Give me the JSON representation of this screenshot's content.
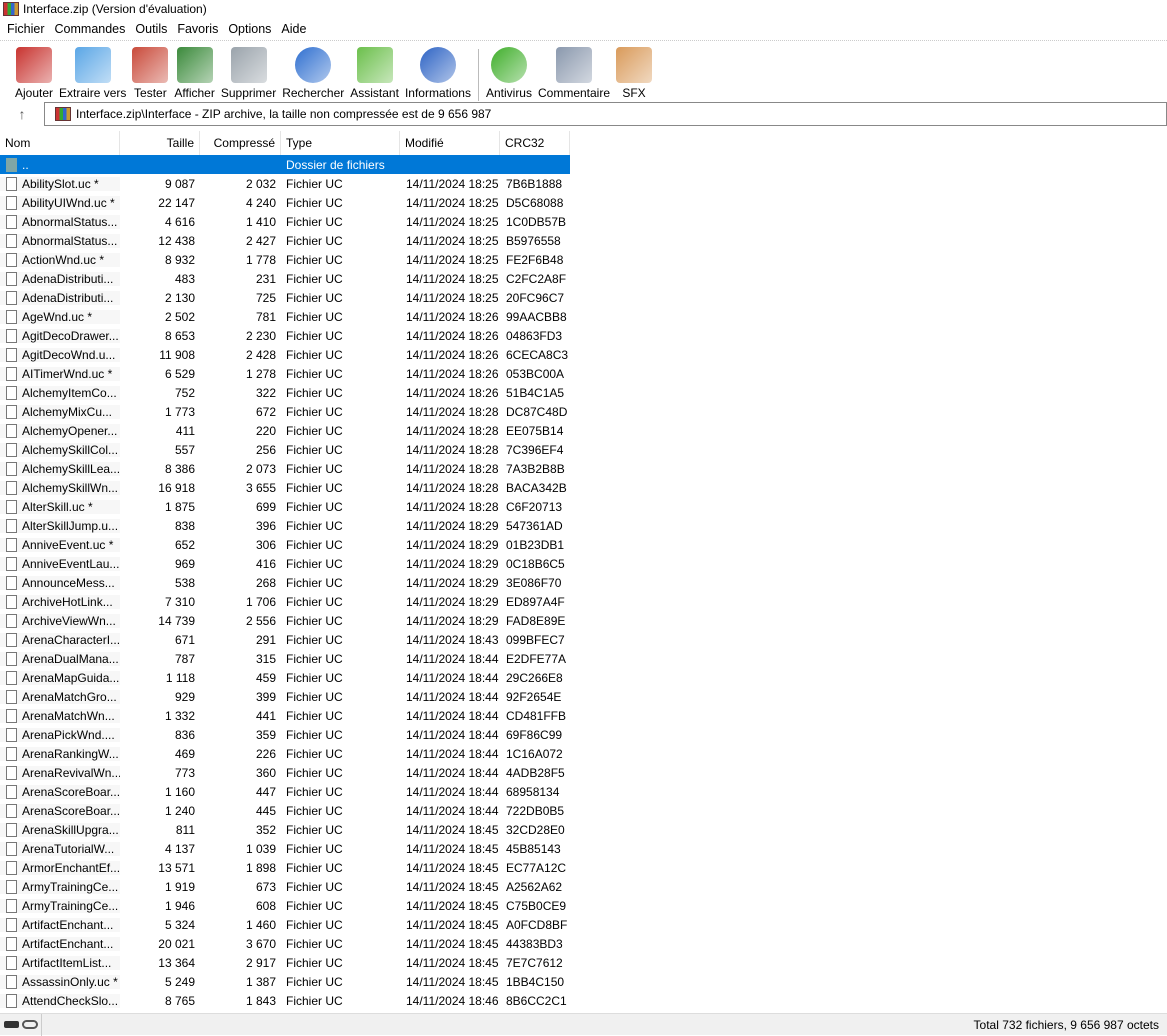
{
  "window": {
    "title": "Interface.zip (Version d'évaluation)"
  },
  "menu": [
    "Fichier",
    "Commandes",
    "Outils",
    "Favoris",
    "Options",
    "Aide"
  ],
  "toolbar": [
    {
      "label": "Ajouter",
      "icon": "add-archive-icon",
      "color": "#c8332f"
    },
    {
      "label": "Extraire vers",
      "icon": "extract-folder-icon",
      "color": "#5aa6e6"
    },
    {
      "label": "Tester",
      "icon": "test-clipboard-icon",
      "color": "#c94a3a"
    },
    {
      "label": "Afficher",
      "icon": "view-book-icon",
      "color": "#3b8a3b"
    },
    {
      "label": "Supprimer",
      "icon": "trash-icon",
      "color": "#9aa3ab"
    },
    {
      "label": "Rechercher",
      "icon": "magnifier-icon",
      "color": "#2f6fd0"
    },
    {
      "label": "Assistant",
      "icon": "magic-wand-icon",
      "color": "#6bbf4b"
    },
    {
      "label": "Informations",
      "icon": "info-icon",
      "color": "#2d63c4"
    },
    {
      "label": "Antivirus",
      "icon": "antivirus-bug-icon",
      "color": "#3fae2a"
    },
    {
      "label": "Commentaire",
      "icon": "comment-icon",
      "color": "#8a98ad"
    },
    {
      "label": "SFX",
      "icon": "sfx-box-icon",
      "color": "#d99a5a"
    }
  ],
  "address": {
    "path": "Interface.zip\\Interface - ZIP archive, la taille non compressée est de 9 656 987"
  },
  "columns": [
    "Nom",
    "Taille",
    "Compressé",
    "Type",
    "Modifié",
    "CRC32"
  ],
  "parent_row": {
    "name": "..",
    "type": "Dossier de fichiers"
  },
  "files": [
    [
      "AbilitySlot.uc *",
      "9 087",
      "2 032",
      "Fichier UC",
      "14/11/2024 18:25",
      "7B6B1888"
    ],
    [
      "AbilityUIWnd.uc *",
      "22 147",
      "4 240",
      "Fichier UC",
      "14/11/2024 18:25",
      "D5C68088"
    ],
    [
      "AbnormalStatus...",
      "4 616",
      "1 410",
      "Fichier UC",
      "14/11/2024 18:25",
      "1C0DB57B"
    ],
    [
      "AbnormalStatus...",
      "12 438",
      "2 427",
      "Fichier UC",
      "14/11/2024 18:25",
      "B5976558"
    ],
    [
      "ActionWnd.uc *",
      "8 932",
      "1 778",
      "Fichier UC",
      "14/11/2024 18:25",
      "FE2F6B48"
    ],
    [
      "AdenaDistributi...",
      "483",
      "231",
      "Fichier UC",
      "14/11/2024 18:25",
      "C2FC2A8F"
    ],
    [
      "AdenaDistributi...",
      "2 130",
      "725",
      "Fichier UC",
      "14/11/2024 18:25",
      "20FC96C7"
    ],
    [
      "AgeWnd.uc *",
      "2 502",
      "781",
      "Fichier UC",
      "14/11/2024 18:26",
      "99AACBB8"
    ],
    [
      "AgitDecoDrawer...",
      "8 653",
      "2 230",
      "Fichier UC",
      "14/11/2024 18:26",
      "04863FD3"
    ],
    [
      "AgitDecoWnd.u...",
      "11 908",
      "2 428",
      "Fichier UC",
      "14/11/2024 18:26",
      "6CECA8C3"
    ],
    [
      "AITimerWnd.uc *",
      "6 529",
      "1 278",
      "Fichier UC",
      "14/11/2024 18:26",
      "053BC00A"
    ],
    [
      "AlchemyItemCo...",
      "752",
      "322",
      "Fichier UC",
      "14/11/2024 18:26",
      "51B4C1A5"
    ],
    [
      "AlchemyMixCu...",
      "1 773",
      "672",
      "Fichier UC",
      "14/11/2024 18:28",
      "DC87C48D"
    ],
    [
      "AlchemyOpener...",
      "411",
      "220",
      "Fichier UC",
      "14/11/2024 18:28",
      "EE075B14"
    ],
    [
      "AlchemySkillCol...",
      "557",
      "256",
      "Fichier UC",
      "14/11/2024 18:28",
      "7C396EF4"
    ],
    [
      "AlchemySkillLea...",
      "8 386",
      "2 073",
      "Fichier UC",
      "14/11/2024 18:28",
      "7A3B2B8B"
    ],
    [
      "AlchemySkillWn...",
      "16 918",
      "3 655",
      "Fichier UC",
      "14/11/2024 18:28",
      "BACA342B"
    ],
    [
      "AlterSkill.uc *",
      "1 875",
      "699",
      "Fichier UC",
      "14/11/2024 18:28",
      "C6F20713"
    ],
    [
      "AlterSkillJump.u...",
      "838",
      "396",
      "Fichier UC",
      "14/11/2024 18:29",
      "547361AD"
    ],
    [
      "AnniveEvent.uc *",
      "652",
      "306",
      "Fichier UC",
      "14/11/2024 18:29",
      "01B23DB1"
    ],
    [
      "AnniveEventLau...",
      "969",
      "416",
      "Fichier UC",
      "14/11/2024 18:29",
      "0C18B6C5"
    ],
    [
      "AnnounceMess...",
      "538",
      "268",
      "Fichier UC",
      "14/11/2024 18:29",
      "3E086F70"
    ],
    [
      "ArchiveHotLink...",
      "7 310",
      "1 706",
      "Fichier UC",
      "14/11/2024 18:29",
      "ED897A4F"
    ],
    [
      "ArchiveViewWn...",
      "14 739",
      "2 556",
      "Fichier UC",
      "14/11/2024 18:29",
      "FAD8E89E"
    ],
    [
      "ArenaCharacterI...",
      "671",
      "291",
      "Fichier UC",
      "14/11/2024 18:43",
      "099BFEC7"
    ],
    [
      "ArenaDualMana...",
      "787",
      "315",
      "Fichier UC",
      "14/11/2024 18:44",
      "E2DFE77A"
    ],
    [
      "ArenaMapGuida...",
      "1 118",
      "459",
      "Fichier UC",
      "14/11/2024 18:44",
      "29C266E8"
    ],
    [
      "ArenaMatchGro...",
      "929",
      "399",
      "Fichier UC",
      "14/11/2024 18:44",
      "92F2654E"
    ],
    [
      "ArenaMatchWn...",
      "1 332",
      "441",
      "Fichier UC",
      "14/11/2024 18:44",
      "CD481FFB"
    ],
    [
      "ArenaPickWnd....",
      "836",
      "359",
      "Fichier UC",
      "14/11/2024 18:44",
      "69F86C99"
    ],
    [
      "ArenaRankingW...",
      "469",
      "226",
      "Fichier UC",
      "14/11/2024 18:44",
      "1C16A072"
    ],
    [
      "ArenaRevivalWn...",
      "773",
      "360",
      "Fichier UC",
      "14/11/2024 18:44",
      "4ADB28F5"
    ],
    [
      "ArenaScoreBoar...",
      "1 160",
      "447",
      "Fichier UC",
      "14/11/2024 18:44",
      "68958134"
    ],
    [
      "ArenaScoreBoar...",
      "1 240",
      "445",
      "Fichier UC",
      "14/11/2024 18:44",
      "722DB0B5"
    ],
    [
      "ArenaSkillUpgra...",
      "811",
      "352",
      "Fichier UC",
      "14/11/2024 18:45",
      "32CD28E0"
    ],
    [
      "ArenaTutorialW...",
      "4 137",
      "1 039",
      "Fichier UC",
      "14/11/2024 18:45",
      "45B85143"
    ],
    [
      "ArmorEnchantEf...",
      "13 571",
      "1 898",
      "Fichier UC",
      "14/11/2024 18:45",
      "EC77A12C"
    ],
    [
      "ArmyTrainingCe...",
      "1 919",
      "673",
      "Fichier UC",
      "14/11/2024 18:45",
      "A2562A62"
    ],
    [
      "ArmyTrainingCe...",
      "1 946",
      "608",
      "Fichier UC",
      "14/11/2024 18:45",
      "C75B0CE9"
    ],
    [
      "ArtifactEnchant...",
      "5 324",
      "1 460",
      "Fichier UC",
      "14/11/2024 18:45",
      "A0FCD8BF"
    ],
    [
      "ArtifactEnchant...",
      "20 021",
      "3 670",
      "Fichier UC",
      "14/11/2024 18:45",
      "44383BD3"
    ],
    [
      "ArtifactItemList...",
      "13 364",
      "2 917",
      "Fichier UC",
      "14/11/2024 18:45",
      "7E7C7612"
    ],
    [
      "AssassinOnly.uc *",
      "5 249",
      "1 387",
      "Fichier UC",
      "14/11/2024 18:45",
      "1BB4C150"
    ],
    [
      "AttendCheckSlo...",
      "8 765",
      "1 843",
      "Fichier UC",
      "14/11/2024 18:46",
      "8B6CC2C1"
    ]
  ],
  "status": {
    "total": "Total 732 fichiers, 9 656 987 octets"
  }
}
